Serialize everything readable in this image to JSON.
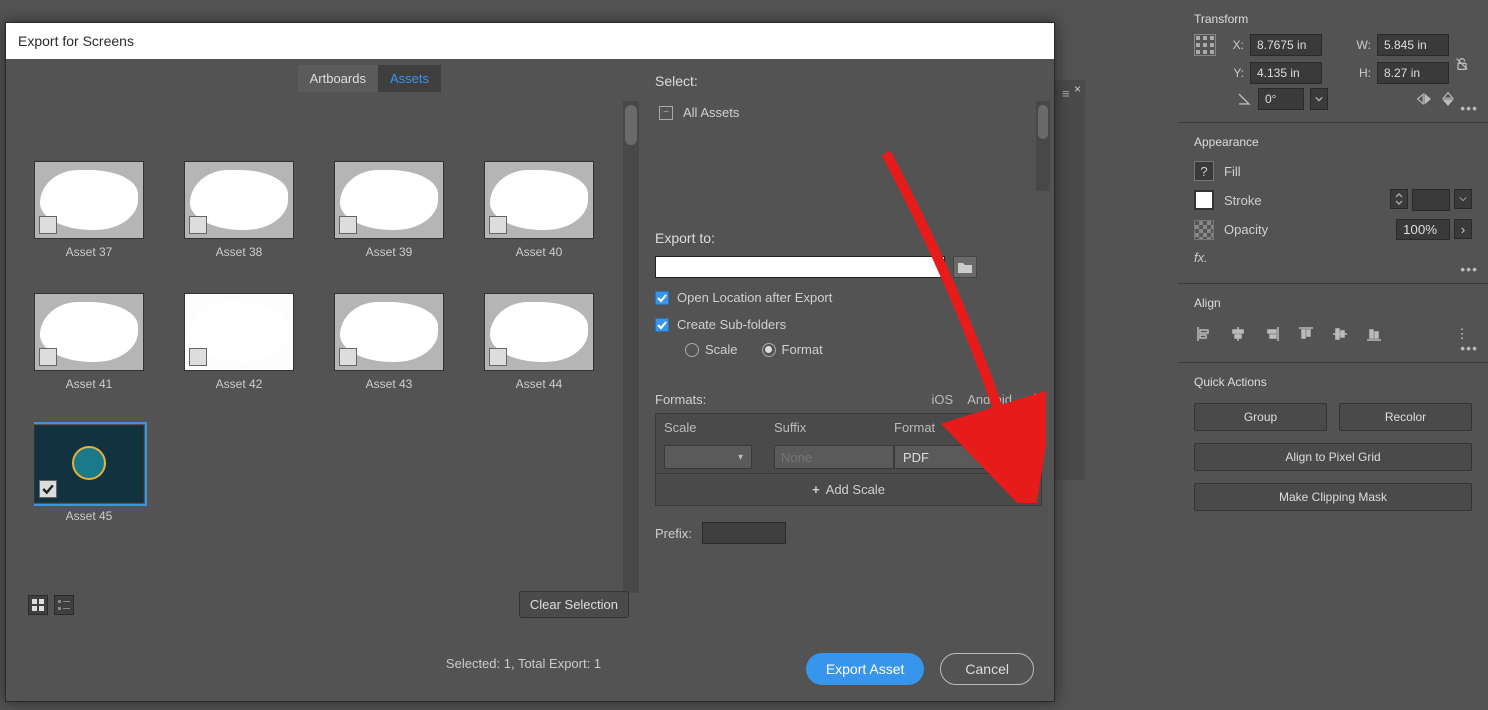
{
  "dialog": {
    "title": "Export for Screens",
    "tabs": {
      "artboards": "Artboards",
      "assets": "Assets"
    },
    "assets": [
      {
        "label": "Asset 37"
      },
      {
        "label": "Asset 38"
      },
      {
        "label": "Asset 39"
      },
      {
        "label": "Asset 40"
      },
      {
        "label": "Asset 41"
      },
      {
        "label": "Asset 42"
      },
      {
        "label": "Asset 43"
      },
      {
        "label": "Asset 44"
      },
      {
        "label": "Asset 45",
        "selected": true
      }
    ],
    "clearSelection": "Clear Selection",
    "selectedText": "Selected: 1, Total Export: 1",
    "selectLabel": "Select:",
    "allAssets": "All Assets",
    "exportToLabel": "Export to:",
    "openAfter": "Open Location after Export",
    "createSub": "Create Sub-folders",
    "scaleRadio": "Scale",
    "formatRadio": "Format",
    "formatsLabel": "Formats:",
    "ios": "iOS",
    "android": "Android",
    "colScale": "Scale",
    "colSuffix": "Suffix",
    "colFormat": "Format",
    "suffixPlaceholder": "None",
    "formatValue": "PDF",
    "addScale": "Add Scale",
    "prefixLabel": "Prefix:",
    "exportBtn": "Export Asset",
    "cancelBtn": "Cancel"
  },
  "transform": {
    "header": "Transform",
    "x": "8.7675 in",
    "y": "4.135 in",
    "w": "5.845 in",
    "h": "8.27 in",
    "xL": "X:",
    "yL": "Y:",
    "wL": "W:",
    "hL": "H:",
    "angle": "0°"
  },
  "appearance": {
    "header": "Appearance",
    "fill": "Fill",
    "stroke": "Stroke",
    "opacity": "Opacity",
    "opVal": "100%",
    "fx": "fx."
  },
  "align": {
    "header": "Align"
  },
  "quick": {
    "header": "Quick Actions",
    "group": "Group",
    "recolor": "Recolor",
    "pixel": "Align to Pixel Grid",
    "clip": "Make Clipping Mask"
  }
}
